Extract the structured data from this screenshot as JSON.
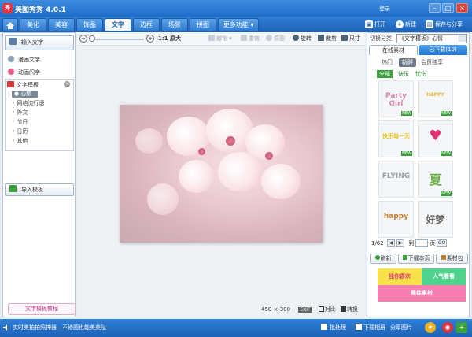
{
  "window": {
    "title": "美图秀秀 4.0.1",
    "logo_text": "秀",
    "links": [
      "登录",
      "|",
      "[",
      "]"
    ],
    "login": "登录",
    "minimize": "–",
    "maximize": "□",
    "close": "×"
  },
  "tabs": [
    {
      "label": "美化"
    },
    {
      "label": "美容"
    },
    {
      "label": "饰品"
    },
    {
      "label": "文字"
    },
    {
      "label": "边框"
    },
    {
      "label": "场景"
    },
    {
      "label": "拼图"
    },
    {
      "label": "更多功能 ▾"
    }
  ],
  "actions": {
    "open": "打开",
    "new": "新建",
    "save_share": "保存与分享"
  },
  "subbar": {
    "original_size": "1:1 原大",
    "undo": "撤销",
    "undo_arrow": "▾",
    "redo": "重做",
    "original": "原图",
    "rotate": "旋转",
    "crop": "裁剪",
    "resize": "尺寸"
  },
  "left_panel": {
    "input_text": "输入文字",
    "comic_text": "漫画文字",
    "animated_text": "动画闪字",
    "template_head": "文字模板",
    "tree": [
      "● 心情",
      "◦ 网络流行语",
      "◦ 外文",
      "◦ 节日",
      "◦ 日历",
      "◦ 其他"
    ],
    "import_template": "导入模板",
    "tutorial": "文字模板教程"
  },
  "canvas": {
    "size_w": "450",
    "size_x": "×",
    "size_h": "300",
    "exif": "EXIF",
    "compare": "对比",
    "flip": "转换"
  },
  "right_panel": {
    "switch_label": "切换分类",
    "category": "《文字模板》心情",
    "tab_online": "在线素材",
    "tab_downloaded": "已下载(10)",
    "sub_tabs": [
      "热门",
      "新鲜",
      "会员独享"
    ],
    "filters": [
      "全部",
      "快乐",
      "忧伤"
    ],
    "thumbs": [
      {
        "text": "Party Girl",
        "color": "#d98aa8",
        "new": "NEW"
      },
      {
        "text": "HAPPY",
        "color": "#e3b43a",
        "new": "NEW"
      },
      {
        "text": "快乐每一天",
        "color": "#e8c51e",
        "new": "NEW"
      },
      {
        "text": "♥",
        "color": "#e0306f",
        "new": "NEW"
      },
      {
        "text": "FLYING",
        "color": "#9aa0a6",
        "new": ""
      },
      {
        "text": "夏",
        "color": "#6bb04a",
        "new": "NEW"
      },
      {
        "text": "happy",
        "color": "#c7802e",
        "new": ""
      },
      {
        "text": "好梦",
        "color": "#666666",
        "new": ""
      }
    ],
    "page": "1/62",
    "page_to": "到",
    "page_unit": "页",
    "go": "GO",
    "refresh": "刷新",
    "download_page": "下载本页",
    "material_pack": "素材包",
    "banner_left": "独你喜欢",
    "banner_right": "人气看看",
    "banner_bottom": "最佳素材"
  },
  "statusbar": {
    "tip": "实时美拍拍照神器—不修图也能美美哒",
    "batch": "批处理",
    "download": "下载相册",
    "share": "分享图片"
  },
  "colors": {
    "accent": "#1e63b6",
    "green": "#3aa23a",
    "pink": "#e5a9c9"
  }
}
